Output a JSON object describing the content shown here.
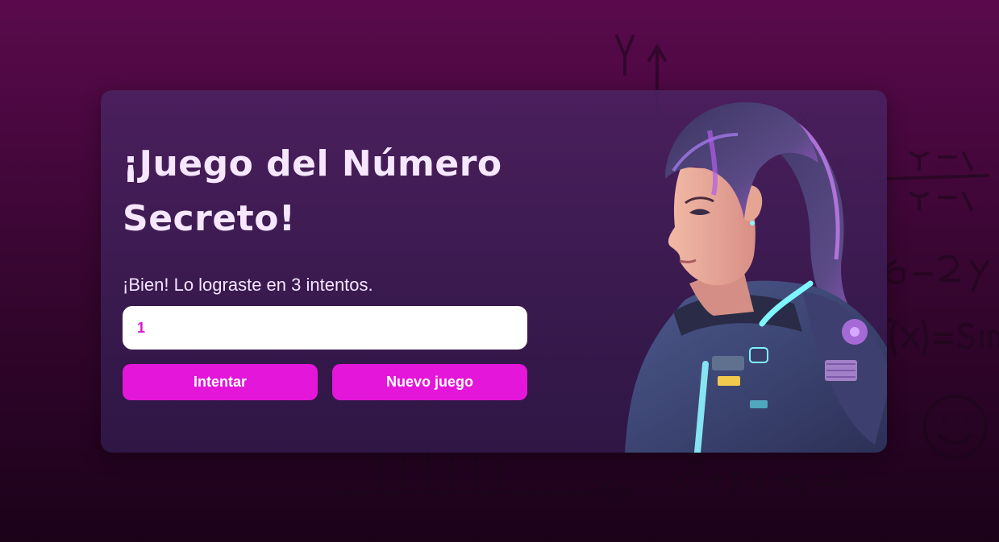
{
  "game": {
    "title": "¡Juego del Número Secreto!",
    "message": "¡Bien! Lo lograste en 3 intentos.",
    "input_value": "1",
    "try_button": "Intentar",
    "new_game_button": "Nuevo juego"
  },
  "colors": {
    "accent": "#e416d9",
    "title_text": "#f6e7ff",
    "background_top": "#5a0a4c",
    "background_bottom": "#1b0219"
  },
  "illustration": {
    "subject": "astronaut-girl-illustration",
    "decoration": "handwritten-math-formulas"
  }
}
